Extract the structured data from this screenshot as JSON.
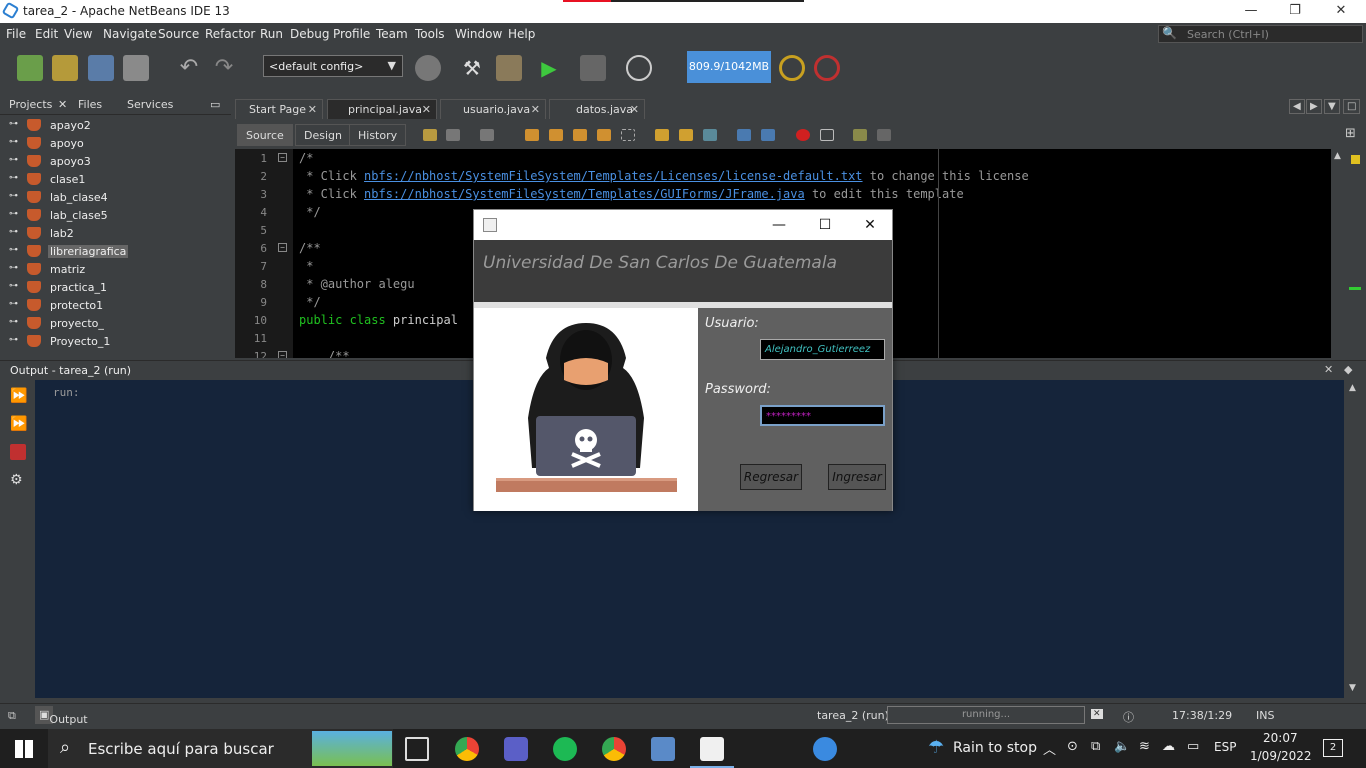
{
  "window": {
    "title": "tarea_2 - Apache NetBeans IDE 13",
    "minimize": "—",
    "maximize": "❐",
    "close": "✕"
  },
  "menu": [
    "File",
    "Edit",
    "View",
    "Navigate",
    "Source",
    "Refactor",
    "Run",
    "Debug",
    "Profile",
    "Team",
    "Tools",
    "Window",
    "Help"
  ],
  "search": {
    "placeholder": "Search (Ctrl+I)"
  },
  "toolbar": {
    "config": "<default config>",
    "memory": "809.9/1042MB"
  },
  "left_panel": {
    "tabs": [
      "Projects",
      "Files",
      "Services"
    ],
    "projects": [
      "apayo2",
      "apoyo",
      "apoyo3",
      "clase1",
      "lab_clase4",
      "lab_clase5",
      "lab2",
      "libreriagrafica",
      "matriz",
      "practica_1",
      "protecto1",
      "proyecto_",
      "Proyecto_1"
    ],
    "selected": "libreriagrafica"
  },
  "editor": {
    "tabs": [
      "Start Page",
      "principal.java",
      "usuario.java",
      "datos.java"
    ],
    "active_tab": "principal.java",
    "views": [
      "Source",
      "Design",
      "History"
    ],
    "active_view": "Source",
    "line_numbers": [
      "1",
      "2",
      "3",
      "4",
      "5",
      "6",
      "7",
      "8",
      "9",
      "10",
      "11",
      "12"
    ],
    "code": {
      "l1": "/*",
      "l2a": " * Click ",
      "l2link": "nbfs://nbhost/SystemFileSystem/Templates/Licenses/license-default.txt",
      "l2b": " to change this license",
      "l3a": " * Click ",
      "l3link": "nbfs://nbhost/SystemFileSystem/Templates/GUIForms/JFrame.java",
      "l3b": " to edit this template",
      "l4": " */",
      "l6": "/**",
      "l7": " *",
      "l8": " * @author alegu",
      "l9": " */",
      "l10kw": "public class ",
      "l10": "principal",
      "l12": "    /**"
    }
  },
  "output": {
    "title": "Output - tarea_2 (run)",
    "text": "run:"
  },
  "status": {
    "output_tab": "Output",
    "process": "tarea_2 (run)",
    "progress": "running...",
    "position": "17:38/1:29",
    "mode": "INS"
  },
  "dialog": {
    "header": "Universidad De San Carlos De Guatemala",
    "user_label": "Usuario:",
    "user_value": "Alejandro_Gutierreez",
    "pass_label": "Password:",
    "pass_value": "*********",
    "back_button": "Regresar",
    "login_button": "Ingresar",
    "minimize": "—",
    "maximize": "☐",
    "close": "✕"
  },
  "taskbar": {
    "search": "Escribe aquí para buscar",
    "weather": "Rain to stop",
    "lang": "ESP",
    "time": "20:07",
    "date": "1/09/2022",
    "notifications": "2"
  },
  "colors": {
    "accent": "#4a90d9",
    "output_bg": "#15243a",
    "editor_bg": "#000000"
  }
}
